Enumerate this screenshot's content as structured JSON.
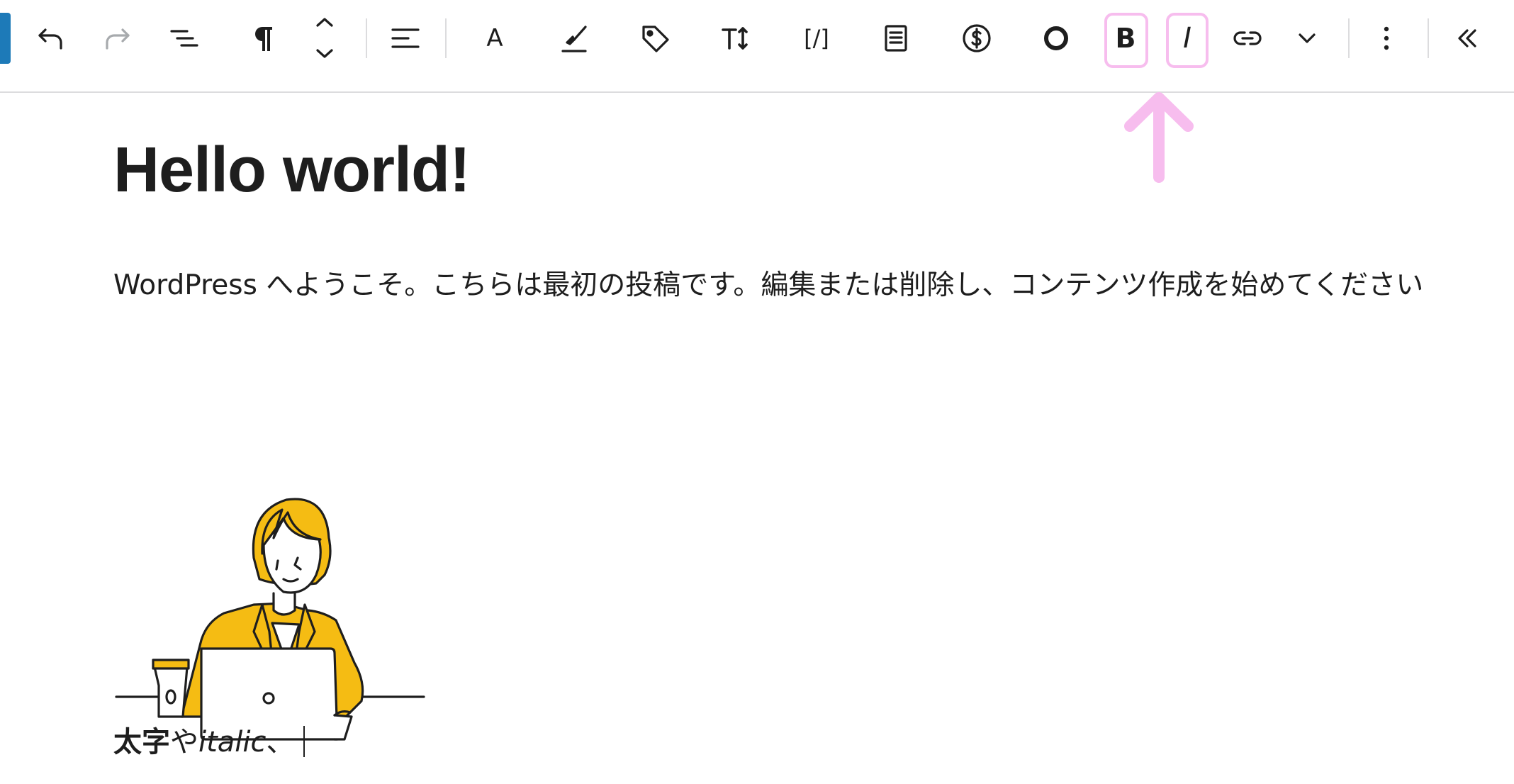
{
  "toolbar": {
    "buttons": [
      {
        "label": "Undo",
        "icon": "undo-icon",
        "enabled": true
      },
      {
        "label": "Redo",
        "icon": "redo-icon",
        "enabled": false
      },
      {
        "label": "Document outline",
        "icon": "list-view-icon"
      },
      {
        "label": "Paragraph",
        "icon": "pilcrow-icon"
      },
      {
        "label": "Move up / down",
        "icon": "chevron-up-down-icon"
      },
      {
        "label": "Align text",
        "icon": "align-left-icon"
      },
      {
        "label": "Font",
        "icon": "letter-a-icon",
        "glyph": "A"
      },
      {
        "label": "Highlighter",
        "icon": "paintbrush-icon"
      },
      {
        "label": "Tag",
        "icon": "tag-icon"
      },
      {
        "label": "Font size",
        "icon": "font-size-icon"
      },
      {
        "label": "Inline code",
        "icon": "inline-code-icon",
        "glyph": "[/]"
      },
      {
        "label": "Document",
        "icon": "document-icon"
      },
      {
        "label": "Currency",
        "icon": "dollar-circle-icon"
      },
      {
        "label": "Circle",
        "icon": "circle-icon"
      },
      {
        "label": "Bold",
        "icon": "bold-icon",
        "glyph": "B",
        "highlighted": true
      },
      {
        "label": "Italic",
        "icon": "italic-icon",
        "glyph": "I",
        "highlighted": true
      },
      {
        "label": "Link",
        "icon": "link-icon"
      },
      {
        "label": "More rich text controls",
        "icon": "chevron-down-icon"
      },
      {
        "label": "Options",
        "icon": "more-vertical-icon"
      },
      {
        "label": "Collapse",
        "icon": "chevrons-left-icon"
      }
    ]
  },
  "annotation": {
    "color": "#f7bdee",
    "target": "bold and italic buttons"
  },
  "accent_color": "#1d7ab8",
  "post": {
    "title": "Hello world!",
    "paragraph": "WordPress へようこそ。こちらは最初の投稿です。編集または削除し、コンテンツ作成を始めてください",
    "image": {
      "subject": "woman working at laptop illustration",
      "accent_color": "#f5bc13"
    },
    "second_paragraph": {
      "bold": "太字",
      "plain": "や",
      "italic": "italic",
      "tail": "、"
    }
  }
}
